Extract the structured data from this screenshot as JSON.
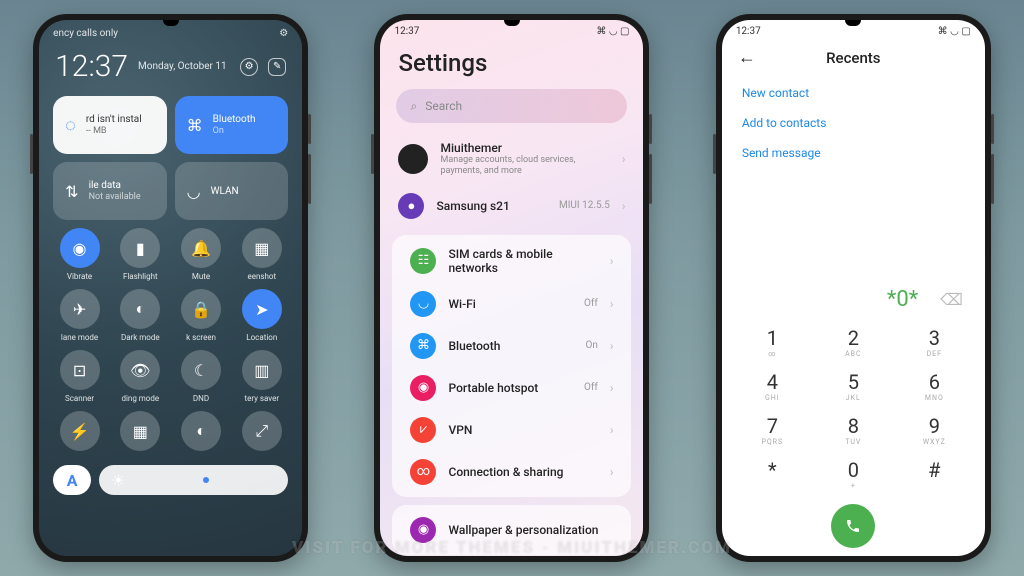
{
  "watermark": "VISIT FOR MORE THEMES - MIUITHEMER.COM",
  "phone1": {
    "status_left": "ency calls only",
    "time": "12:37",
    "date": "Monday, October 11",
    "tile_storage": {
      "title": "rd isn't instal",
      "sub": "-- MB"
    },
    "tile_bt": {
      "title": "Bluetooth",
      "sub": "On"
    },
    "tile_data": {
      "title": "ile data",
      "sub": "Not available"
    },
    "tile_wlan": {
      "title": "WLAN",
      "sub": ""
    },
    "qs": [
      "Vibrate",
      "Flashlight",
      "Mute",
      "eenshot",
      "lane mode",
      "Dark mode",
      "k screen",
      "Location",
      "Scanner",
      "ding mode",
      "DND",
      "tery saver"
    ]
  },
  "phone2": {
    "time": "12:37",
    "title": "Settings",
    "search": "Search",
    "account": {
      "name": "Miuithemer",
      "sub": "Manage accounts, cloud services, payments, and more"
    },
    "theme": {
      "name": "Samsung s21",
      "badge": "MIUI 12.5.5"
    },
    "items": [
      {
        "label": "SIM cards & mobile networks",
        "val": "",
        "color": "#4caf50"
      },
      {
        "label": "Wi-Fi",
        "val": "Off",
        "color": "#2196f3"
      },
      {
        "label": "Bluetooth",
        "val": "On",
        "color": "#2196f3"
      },
      {
        "label": "Portable hotspot",
        "val": "Off",
        "color": "#e91e63"
      },
      {
        "label": "VPN",
        "val": "",
        "color": "#f44336"
      },
      {
        "label": "Connection & sharing",
        "val": "",
        "color": "#f44336"
      }
    ],
    "wallpaper": "Wallpaper & personalization"
  },
  "phone3": {
    "time": "12:37",
    "title": "Recents",
    "links": [
      "New contact",
      "Add to contacts",
      "Send message"
    ],
    "entered": "*0*",
    "keys": [
      {
        "n": "1",
        "s": "∞"
      },
      {
        "n": "2",
        "s": "ABC"
      },
      {
        "n": "3",
        "s": "DEF"
      },
      {
        "n": "4",
        "s": "GHI"
      },
      {
        "n": "5",
        "s": "JKL"
      },
      {
        "n": "6",
        "s": "MNO"
      },
      {
        "n": "7",
        "s": "PQRS"
      },
      {
        "n": "8",
        "s": "TUV"
      },
      {
        "n": "9",
        "s": "WXYZ"
      },
      {
        "n": "*",
        "s": ""
      },
      {
        "n": "0",
        "s": "+"
      },
      {
        "n": "#",
        "s": ""
      }
    ]
  }
}
